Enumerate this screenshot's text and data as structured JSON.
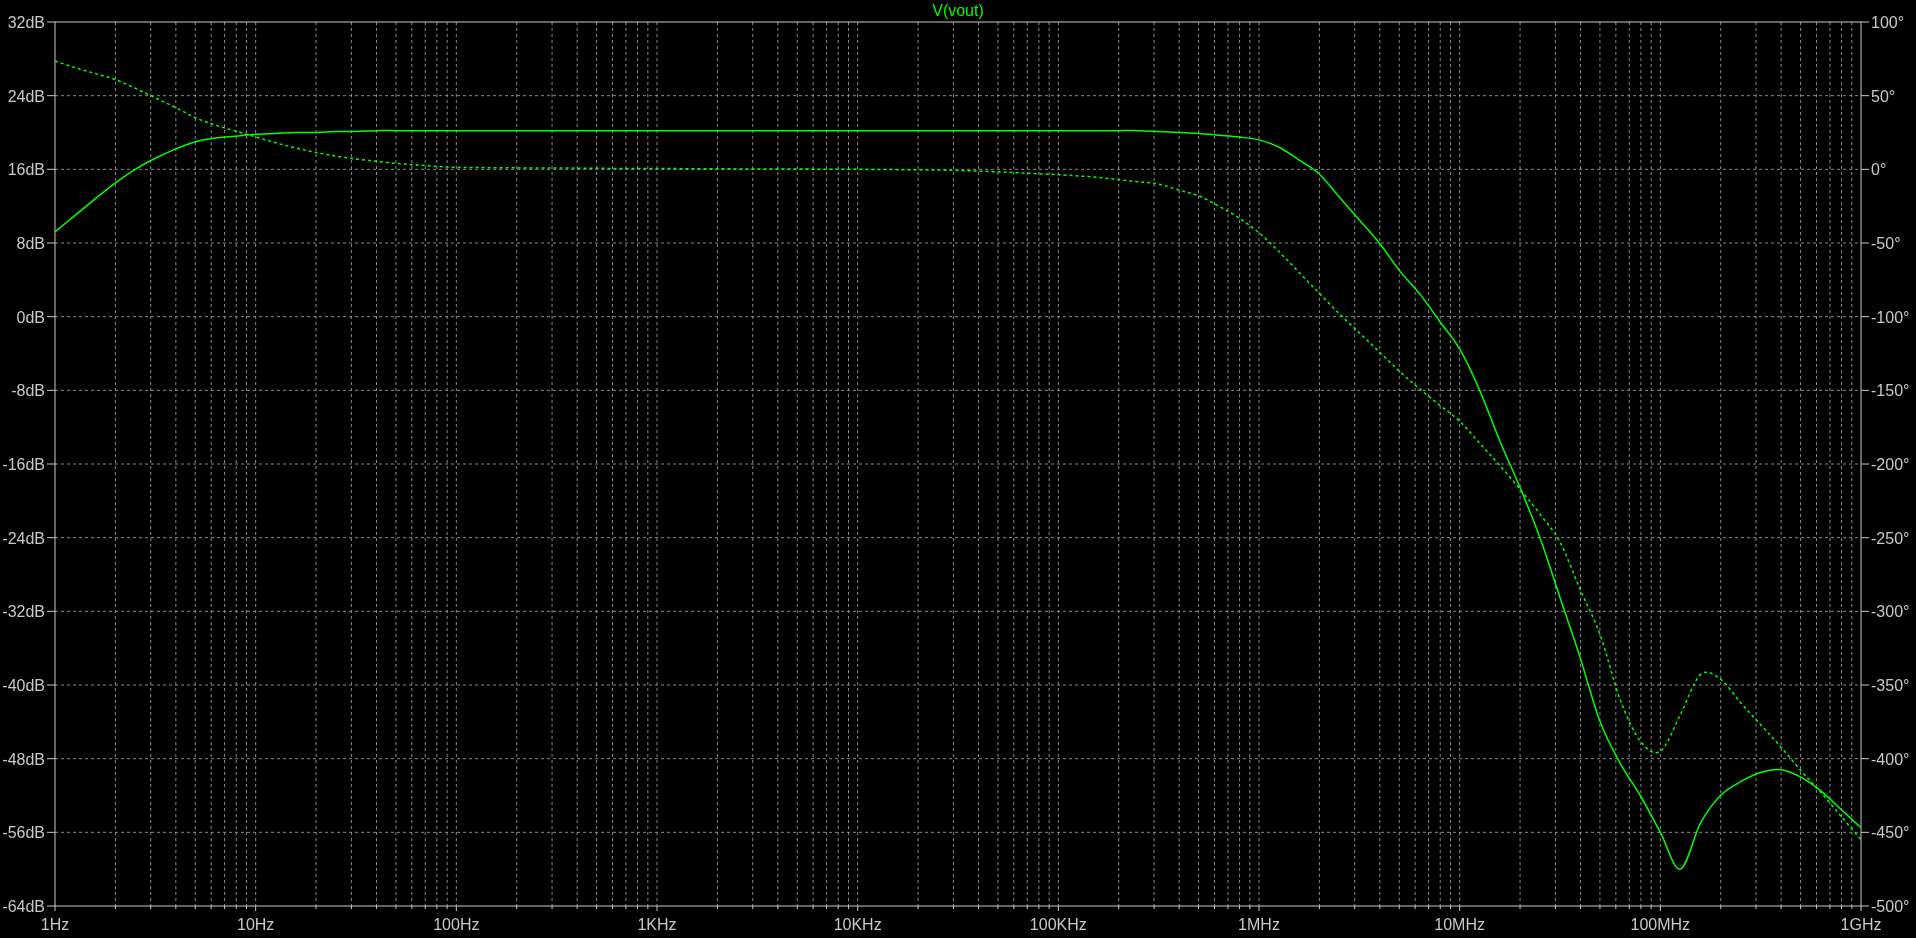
{
  "plot": {
    "chart_data": {
      "type": "line",
      "title": "V(vout)",
      "grid": true,
      "ylim": [
        -64,
        32
      ],
      "y2lim": [
        -500,
        100
      ],
      "categories": [
        "1Hz",
        null,
        null,
        null,
        null,
        null,
        null,
        null,
        null,
        null,
        "10Hz",
        null,
        null,
        null,
        null,
        null,
        null,
        null,
        null,
        null,
        "100Hz",
        null,
        null,
        null,
        null,
        null,
        null,
        null,
        null,
        null,
        "1KHz",
        null,
        null,
        null,
        null,
        null,
        null,
        null,
        null,
        null,
        "10KHz",
        null,
        null,
        null,
        null,
        null,
        null,
        null,
        null,
        null,
        "100KHz",
        null,
        null,
        null,
        null,
        null,
        null,
        null,
        null,
        null,
        "1MHz",
        null,
        null,
        null,
        null,
        null,
        null,
        null,
        null,
        null,
        "10MHz",
        null,
        null,
        null,
        null,
        null,
        null,
        null,
        null,
        null,
        "100MHz",
        null,
        null,
        null,
        null,
        null,
        null,
        null,
        null,
        null,
        "1GHz"
      ],
      "yticks": [
        {
          "value": 32,
          "label": "32dB"
        },
        {
          "value": 24,
          "label": "24dB"
        },
        {
          "value": 16,
          "label": "16dB"
        },
        {
          "value": 8,
          "label": "8dB"
        },
        {
          "value": 0,
          "label": "0dB"
        },
        {
          "value": -8,
          "label": "-8dB"
        },
        {
          "value": -16,
          "label": "-16dB"
        },
        {
          "value": -24,
          "label": "-24dB"
        },
        {
          "value": -32,
          "label": "-32dB"
        },
        {
          "value": -40,
          "label": "-40dB"
        },
        {
          "value": -48,
          "label": "-48dB"
        },
        {
          "value": -56,
          "label": "-56dB"
        },
        {
          "value": -64,
          "label": "-64dB"
        }
      ],
      "y2ticks": [
        {
          "value": 100,
          "label": "100°"
        },
        {
          "value": 50,
          "label": "50°"
        },
        {
          "value": 0,
          "label": "0°"
        },
        {
          "value": -50,
          "label": "-50°"
        },
        {
          "value": -100,
          "label": "-100°"
        },
        {
          "value": -150,
          "label": "-150°"
        },
        {
          "value": -200,
          "label": "-200°"
        },
        {
          "value": -250,
          "label": "-250°"
        },
        {
          "value": -300,
          "label": "-300°"
        },
        {
          "value": -350,
          "label": "-350°"
        },
        {
          "value": -400,
          "label": "-400°"
        },
        {
          "value": -450,
          "label": "-450°"
        },
        {
          "value": -500,
          "label": "-500°"
        }
      ],
      "series": [
        {
          "line_style": "solid",
          "color": "#00ff00",
          "values": [
            9.2,
            11.0,
            12.8,
            14.5,
            16.0,
            17.2,
            18.2,
            19.0,
            19.4,
            19.6,
            19.8,
            19.9,
            20.0,
            20.0,
            20.1,
            20.1,
            20.2,
            20.2,
            20.2,
            20.2,
            20.2,
            20.2,
            20.2,
            20.2,
            20.2,
            20.2,
            20.2,
            20.2,
            20.2,
            20.2,
            20.2,
            20.2,
            20.2,
            20.2,
            20.2,
            20.2,
            20.2,
            20.2,
            20.2,
            20.2,
            20.2,
            20.2,
            20.2,
            20.2,
            20.2,
            20.2,
            20.2,
            20.2,
            20.2,
            20.2,
            20.2,
            20.2,
            20.2,
            20.2,
            20.2,
            20.1,
            20.0,
            19.9,
            19.7,
            19.5,
            19.2,
            18.4,
            17.0,
            15.5,
            13.0,
            10.5,
            8.0,
            5.0,
            2.5,
            -0.5,
            -3.5,
            -8,
            -13.5,
            -18.5,
            -24,
            -30.5,
            -37,
            -44,
            -48.5,
            -52,
            -56,
            -60,
            -55,
            -52,
            -50.5,
            -49.5,
            -49.2,
            -50,
            -51.5,
            -53.5,
            -55.5
          ]
        },
        {
          "axis": "y2",
          "line_style": "dotted",
          "color": "#00ff00",
          "values": [
            73.5,
            69,
            65,
            61,
            55,
            48.5,
            42,
            35,
            30,
            26,
            22,
            18,
            14.5,
            11.5,
            9,
            7,
            5.5,
            4,
            3,
            2,
            1.3,
            1.2,
            1.1,
            1,
            0.9,
            0.9,
            0.8,
            0.7,
            0.6,
            0.6,
            0.5,
            0.5,
            0.4,
            0.4,
            0.3,
            0.3,
            0.2,
            0.2,
            0.1,
            0.1,
            0,
            -0.1,
            -0.2,
            -0.3,
            -0.5,
            -0.8,
            -1.2,
            -1.7,
            -2.3,
            -3,
            -3.6,
            -4.5,
            -5.5,
            -7,
            -8.5,
            -10,
            -14,
            -18,
            -25,
            -33,
            -43,
            -56,
            -70,
            -84,
            -98,
            -111,
            -124,
            -137,
            -149,
            -160,
            -171,
            -186,
            -201,
            -217,
            -234,
            -253,
            -285,
            -316,
            -360,
            -388,
            -395,
            -370,
            -343,
            -346,
            -362,
            -377,
            -392,
            -408,
            -423,
            -439,
            -455
          ]
        }
      ]
    }
  }
}
